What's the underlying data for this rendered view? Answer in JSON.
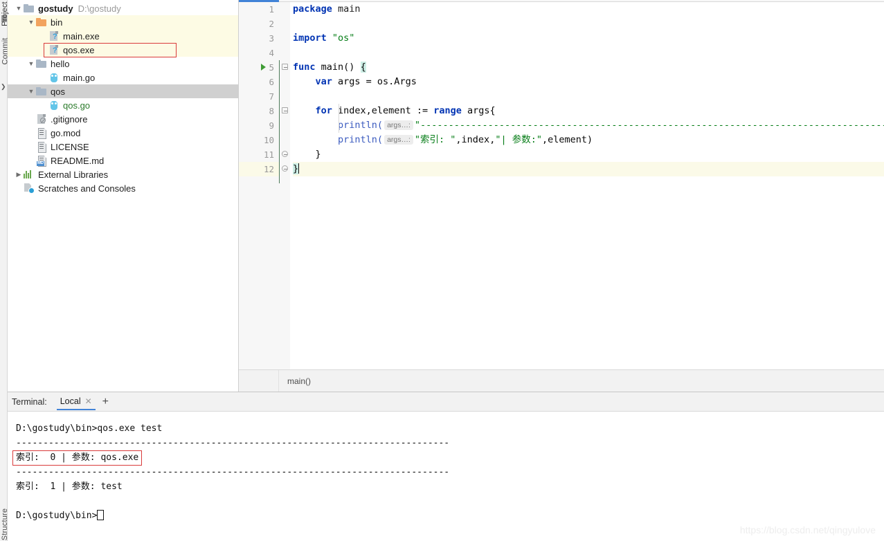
{
  "toolwindows": {
    "project_label": "Project",
    "commit_label": "Commit",
    "structure_label": "Structure"
  },
  "project_tree": {
    "items": [
      {
        "label": "gostudy",
        "path_hint": "D:\\gostudy",
        "icon": "folder-icon",
        "depth": 0,
        "expanded": true,
        "bold": true,
        "highlight": "none"
      },
      {
        "label": "bin",
        "icon": "folder-excluded-icon",
        "depth": 1,
        "expanded": true,
        "bold": false,
        "highlight": "yellow"
      },
      {
        "label": "main.exe",
        "icon": "exe-file-icon",
        "depth": 2,
        "expanded": null,
        "bold": false,
        "highlight": "yellow"
      },
      {
        "label": "qos.exe",
        "icon": "exe-file-icon",
        "depth": 2,
        "expanded": null,
        "bold": false,
        "highlight": "yellow",
        "boxed": true
      },
      {
        "label": "hello",
        "icon": "folder-icon",
        "depth": 1,
        "expanded": true,
        "bold": false,
        "highlight": "none"
      },
      {
        "label": "main.go",
        "icon": "go-file-icon",
        "depth": 2,
        "expanded": null,
        "bold": false,
        "highlight": "none"
      },
      {
        "label": "qos",
        "icon": "folder-icon",
        "depth": 1,
        "expanded": true,
        "bold": false,
        "highlight": "gray"
      },
      {
        "label": "qos.go",
        "icon": "go-file-icon",
        "depth": 2,
        "expanded": null,
        "bold": false,
        "highlight": "none",
        "green": true
      },
      {
        "label": ".gitignore",
        "icon": "gitignore-file-icon",
        "depth": 1,
        "expanded": null,
        "bold": false,
        "highlight": "none"
      },
      {
        "label": "go.mod",
        "icon": "text-file-icon",
        "depth": 1,
        "expanded": null,
        "bold": false,
        "highlight": "none"
      },
      {
        "label": "LICENSE",
        "icon": "text-file-icon",
        "depth": 1,
        "expanded": null,
        "bold": false,
        "highlight": "none"
      },
      {
        "label": "README.md",
        "icon": "markdown-file-icon",
        "depth": 1,
        "expanded": null,
        "bold": false,
        "highlight": "none"
      },
      {
        "label": "External Libraries",
        "icon": "libraries-icon",
        "depth": 0,
        "expanded": false,
        "bold": false,
        "highlight": "none"
      },
      {
        "label": "Scratches and Consoles",
        "icon": "scratches-icon",
        "depth": 0,
        "expanded": null,
        "bold": false,
        "highlight": "none"
      }
    ]
  },
  "editor": {
    "line_numbers": [
      "1",
      "2",
      "3",
      "4",
      "5",
      "6",
      "7",
      "8",
      "9",
      "10",
      "11",
      "12"
    ],
    "current_line": 12,
    "run_marker_line": 5,
    "breadcrumb": "main()",
    "code": {
      "l1_kw": "package",
      "l1_name": "main",
      "l3_kw": "import",
      "l3_str": "\"os\"",
      "l5_kw": "func",
      "l5_name": "main()",
      "l5_brace": "{",
      "l6_kw": "var",
      "l6_rest": " args = os.Args",
      "l8_kw": "for",
      "l8_mid": " index,element := ",
      "l8_kw2": "range",
      "l8_rest": " args{",
      "l9_fn": "println(",
      "l9_hint": "args…:",
      "l9_str": "\"---------------------------------------------------------------------------------------------------------\"",
      "l9_close": ")",
      "l10_fn": "println(",
      "l10_hint": "args…:",
      "l10_str1": "\"索引: \"",
      "l10_mid1": ",index,",
      "l10_str2": "\"| 参数:\"",
      "l10_mid2": ",element)",
      "l11_close": "}",
      "l12_close": "}"
    }
  },
  "terminal": {
    "title": "Terminal:",
    "tab_label": "Local",
    "tab_close": "✕",
    "add_label": "+",
    "lines": [
      {
        "text": "D:\\gostudy\\bin>qos.exe test",
        "style": "plain"
      },
      {
        "text": "--------------------------------------------------------------------------------",
        "style": "plain"
      },
      {
        "text": "索引:  0 | 参数: qos.exe",
        "style": "boxed"
      },
      {
        "text": "--------------------------------------------------------------------------------",
        "style": "plain"
      },
      {
        "text": "索引:  1 | 参数: test",
        "style": "plain"
      },
      {
        "text": "",
        "style": "plain"
      },
      {
        "text": "D:\\gostudy\\bin>",
        "style": "prompt"
      }
    ]
  },
  "watermark": {
    "text": "https://blog.csdn.net/qingyulove"
  },
  "colors": {
    "accent_blue": "#4183d7",
    "selection_gray": "#d0d0d0",
    "excluded_yellow": "#fdfbe4",
    "red_box": "#d93a3a",
    "keyword_blue": "#0033b3",
    "string_green": "#067d17",
    "vcs_green": "#2a7a2a"
  }
}
